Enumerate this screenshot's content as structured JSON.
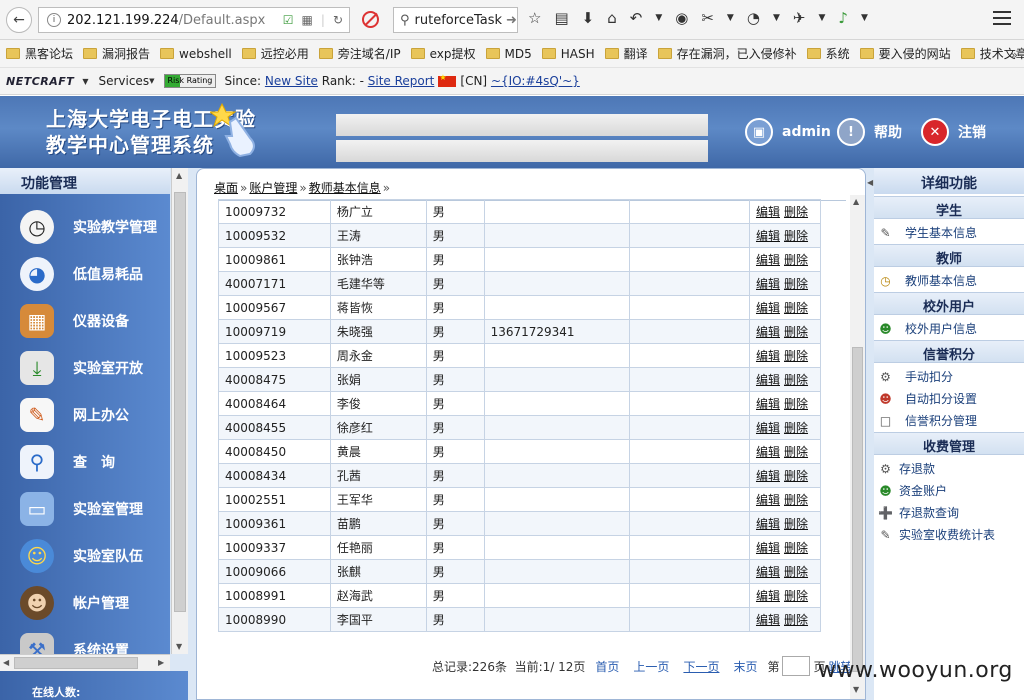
{
  "browser": {
    "url_host": "202.121.199.224",
    "url_path": "/Default.aspx",
    "search_value": "ruteforceTask"
  },
  "bookmarks": [
    "黑客论坛",
    "漏洞报告",
    "webshell",
    "远控必用",
    "旁注域名/IP",
    "exp提权",
    "MD5",
    "HASH",
    "翻译",
    "存在漏洞，已入侵修补",
    "系统",
    "要入侵的网站",
    "技术文章"
  ],
  "netcraft": {
    "logo": "NETCRAFT",
    "services": "Services",
    "risk": "Risk Rating",
    "since_label": "Since:",
    "since_value": "New Site",
    "rank_label": "Rank: -",
    "report": "Site Report",
    "country": "[CN]",
    "host": "~{IO:#4sQ'~}"
  },
  "header": {
    "title_line1": "上海大学电子电工实验",
    "title_line2": "教学中心管理系统",
    "user": "admin",
    "help": "帮助",
    "logout": "注销"
  },
  "left_panel": {
    "title": "功能管理",
    "items": [
      "实验教学管理",
      "低值易耗品",
      "仪器设备",
      "实验室开放",
      "网上办公",
      "查　询",
      "实验室管理",
      "实验室队伍",
      "帐户管理",
      "系统设置"
    ],
    "online": "在线人数:"
  },
  "breadcrumb": [
    "桌面",
    "账户管理",
    "教师基本信息"
  ],
  "table": {
    "edit_label": "编辑",
    "delete_label": "删除",
    "rows": [
      {
        "id": "10009732",
        "name": "杨广立",
        "gender": "男",
        "phone": "",
        "other": ""
      },
      {
        "id": "10009532",
        "name": "王涛",
        "gender": "男",
        "phone": "",
        "other": ""
      },
      {
        "id": "10009861",
        "name": "张钟浩",
        "gender": "男",
        "phone": "",
        "other": ""
      },
      {
        "id": "40007171",
        "name": "毛建华等",
        "gender": "男",
        "phone": "",
        "other": ""
      },
      {
        "id": "10009567",
        "name": "蒋皆恢",
        "gender": "男",
        "phone": "",
        "other": ""
      },
      {
        "id": "10009719",
        "name": "朱晓强",
        "gender": "男",
        "phone": "13671729341",
        "other": ""
      },
      {
        "id": "10009523",
        "name": "周永金",
        "gender": "男",
        "phone": "",
        "other": ""
      },
      {
        "id": "40008475",
        "name": "张娟",
        "gender": "男",
        "phone": "",
        "other": ""
      },
      {
        "id": "40008464",
        "name": "李俊",
        "gender": "男",
        "phone": "",
        "other": ""
      },
      {
        "id": "40008455",
        "name": "徐彦红",
        "gender": "男",
        "phone": "",
        "other": ""
      },
      {
        "id": "40008450",
        "name": "黄晨",
        "gender": "男",
        "phone": "",
        "other": ""
      },
      {
        "id": "40008434",
        "name": "孔茜",
        "gender": "男",
        "phone": "",
        "other": ""
      },
      {
        "id": "10002551",
        "name": "王军华",
        "gender": "男",
        "phone": "",
        "other": ""
      },
      {
        "id": "10009361",
        "name": "苗鹏",
        "gender": "男",
        "phone": "",
        "other": ""
      },
      {
        "id": "10009337",
        "name": "任艳丽",
        "gender": "男",
        "phone": "",
        "other": ""
      },
      {
        "id": "10009066",
        "name": "张麒",
        "gender": "男",
        "phone": "",
        "other": ""
      },
      {
        "id": "10008991",
        "name": "赵海武",
        "gender": "男",
        "phone": "",
        "other": ""
      },
      {
        "id": "10008990",
        "name": "李国平",
        "gender": "男",
        "phone": "",
        "other": ""
      }
    ]
  },
  "pager": {
    "total": "总记录:226条",
    "current": "当前:1/ 12页",
    "first": "首页",
    "prev": "上一页",
    "next": "下一页",
    "last": "末页",
    "page_prefix": "第",
    "page_suffix": "页",
    "jump": "跳转"
  },
  "right_panel": {
    "title": "详细功能",
    "sections": [
      {
        "title": "学生",
        "items": [
          "学生基本信息"
        ]
      },
      {
        "title": "教师",
        "items": [
          "教师基本信息"
        ]
      },
      {
        "title": "校外用户",
        "items": [
          "校外用户信息"
        ]
      },
      {
        "title": "信誉积分",
        "items": [
          "手动扣分",
          "自动扣分设置",
          "信誉积分管理"
        ]
      },
      {
        "title": "收费管理",
        "items": [
          "存退款",
          "资金账户",
          "存退款查询",
          "实验室收费统计表"
        ]
      }
    ]
  },
  "watermark": "www.wooyun.org"
}
